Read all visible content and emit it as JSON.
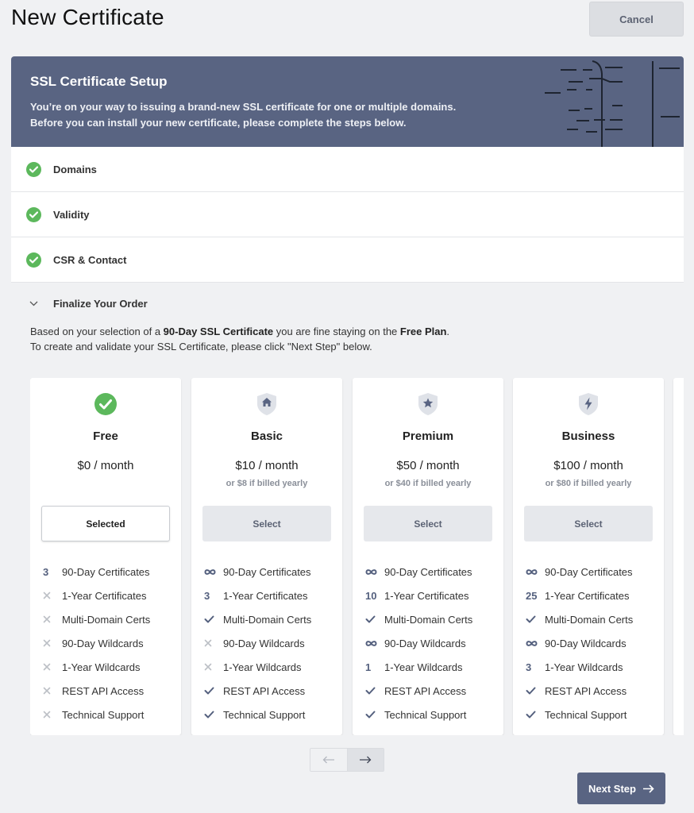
{
  "page": {
    "title": "New Certificate",
    "cancel_label": "Cancel"
  },
  "banner": {
    "title": "SSL Certificate Setup",
    "line1": "You’re on your way to issuing a brand-new SSL certificate for one or multiple domains.",
    "line2": "Before you can install your new certificate, please complete the steps below."
  },
  "steps": [
    {
      "label": "Domains",
      "status": "complete"
    },
    {
      "label": "Validity",
      "status": "complete"
    },
    {
      "label": "CSR & Contact",
      "status": "complete"
    }
  ],
  "finalize": {
    "label": "Finalize Your Order",
    "desc_pre": "Based on your selection of a ",
    "desc_cert": "90-Day SSL Certificate",
    "desc_mid": " you are fine staying on the ",
    "desc_plan": "Free Plan",
    "desc_end": ".",
    "desc_line2": "To create and validate your SSL Certificate, please click \"Next Step\" below."
  },
  "plans": [
    {
      "name": "Free",
      "icon": "check-circle-icon",
      "price": "$0 / month",
      "yearly": "",
      "button": "Selected",
      "selected": true,
      "features": [
        [
          "3",
          "90-Day Certificates"
        ],
        [
          "x",
          "1-Year Certificates"
        ],
        [
          "x",
          "Multi-Domain Certs"
        ],
        [
          "x",
          "90-Day Wildcards"
        ],
        [
          "x",
          "1-Year Wildcards"
        ],
        [
          "x",
          "REST API Access"
        ],
        [
          "x",
          "Technical Support"
        ]
      ]
    },
    {
      "name": "Basic",
      "icon": "home-shield-icon",
      "price": "$10 / month",
      "yearly": "or $8 if billed yearly",
      "button": "Select",
      "selected": false,
      "features": [
        [
          "inf",
          "90-Day Certificates"
        ],
        [
          "3",
          "1-Year Certificates"
        ],
        [
          "check",
          "Multi-Domain Certs"
        ],
        [
          "x",
          "90-Day Wildcards"
        ],
        [
          "x",
          "1-Year Wildcards"
        ],
        [
          "check",
          "REST API Access"
        ],
        [
          "check",
          "Technical Support"
        ]
      ]
    },
    {
      "name": "Premium",
      "icon": "star-shield-icon",
      "price": "$50 / month",
      "yearly": "or $40 if billed yearly",
      "button": "Select",
      "selected": false,
      "features": [
        [
          "inf",
          "90-Day Certificates"
        ],
        [
          "10",
          "1-Year Certificates"
        ],
        [
          "check",
          "Multi-Domain Certs"
        ],
        [
          "inf",
          "90-Day Wildcards"
        ],
        [
          "1",
          "1-Year Wildcards"
        ],
        [
          "check",
          "REST API Access"
        ],
        [
          "check",
          "Technical Support"
        ]
      ]
    },
    {
      "name": "Business",
      "icon": "bolt-shield-icon",
      "price": "$100 / month",
      "yearly": "or $80 if billed yearly",
      "button": "Select",
      "selected": false,
      "features": [
        [
          "inf",
          "90-Day Certificates"
        ],
        [
          "25",
          "1-Year Certificates"
        ],
        [
          "check",
          "Multi-Domain Certs"
        ],
        [
          "inf",
          "90-Day Wildcards"
        ],
        [
          "3",
          "1-Year Wildcards"
        ],
        [
          "check",
          "REST API Access"
        ],
        [
          "check",
          "Technical Support"
        ]
      ]
    }
  ],
  "pager": {
    "prev_icon": "arrow-left-icon",
    "next_icon": "arrow-right-icon"
  },
  "next_step_label": "Next Step",
  "colors": {
    "accent": "#596482",
    "success": "#5cb85c",
    "background": "#f0f1f3"
  }
}
